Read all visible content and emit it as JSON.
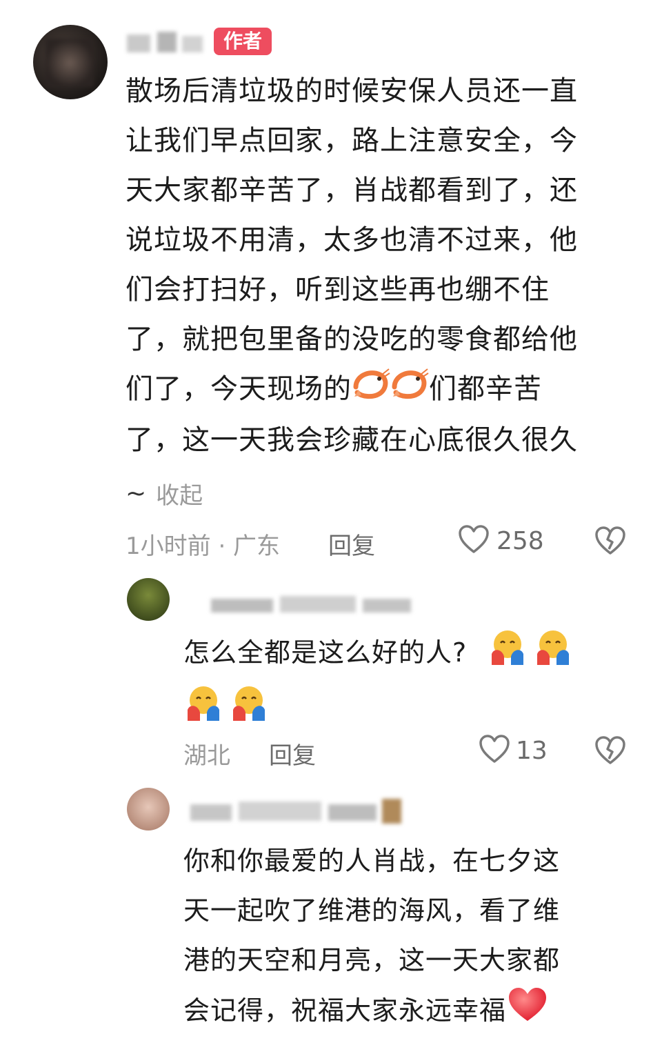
{
  "author_comment": {
    "badge": "作者",
    "lines": [
      "散场后清垃圾的时候安保人员还一直",
      "让我们早点回家，路上注意安全，今",
      "天大家都辛苦了，肖战都看到了，还",
      "说垃圾不用清，太多也清不过来，他",
      "们会打扫好，听到这些再也绷不住",
      "了，就把包里备的没吃的零食都给他"
    ],
    "line7_before": "们了，今天现场的",
    "line7_after": "们都辛苦",
    "line8": "了，这一天我会珍藏在心底很久很久",
    "collapse": "收起",
    "time_location": "1小时前 · 广东",
    "reply_label": "回复",
    "likes": "258",
    "emoji_names": [
      "shrimp-emoji",
      "shrimp-emoji"
    ]
  },
  "reply_1": {
    "text": "怎么全都是这么好的人?",
    "location": "湖北",
    "reply_label": "回复",
    "likes": "13",
    "emoji_names": [
      "hugging-face-emoji",
      "hugging-face-emoji",
      "hugging-face-emoji",
      "hugging-face-emoji"
    ]
  },
  "reply_2": {
    "lines": [
      "你和你最爱的人肖战，在七夕这",
      "天一起吹了维港的海风，看了维",
      "港的天空和月亮，这一天大家都"
    ],
    "line4": "会记得，祝福大家永远幸福",
    "emoji_names": [
      "red-heart-emoji"
    ]
  },
  "colors": {
    "badge": "#ee4d5f",
    "text": "#1c1c1c",
    "meta": "#9a9a9a"
  }
}
